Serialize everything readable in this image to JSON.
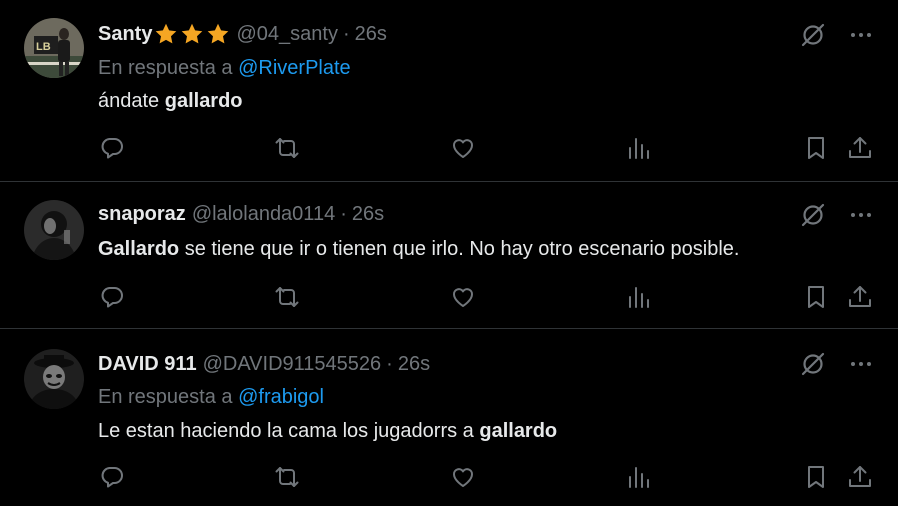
{
  "colors": {
    "background": "#000000",
    "text": "#e7e9ea",
    "muted": "#71767b",
    "link": "#1d9bf0",
    "divider": "#2f3336",
    "star": "#f5a623"
  },
  "tweets": [
    {
      "name": "Santy",
      "badges": [
        "star-icon",
        "star-icon",
        "star-icon"
      ],
      "handle": "@04_santy",
      "dot": "·",
      "time": "26s",
      "reply_prefix": "En respuesta a",
      "reply_to": "@RiverPlate",
      "text_before": "ándate ",
      "text_bold": "gallardo",
      "text_after": ""
    },
    {
      "name": "snaporaz",
      "handle": "@lalolanda0114",
      "dot": "·",
      "time": "26s",
      "text_before": "",
      "text_bold": "Gallardo",
      "text_after": " se tiene que ir o tienen que irlo. No hay otro escenario posible."
    },
    {
      "name": "DAVID 911",
      "handle": "@DAVID911545526",
      "dot": "·",
      "time": "26s",
      "reply_prefix": "En respuesta a",
      "reply_to": "@frabigol",
      "text_before": "Le estan haciendo la cama los jugadorrs a ",
      "text_bold": "gallardo",
      "text_after": ""
    }
  ],
  "icons": {
    "top": [
      "grok-icon",
      "more-icon"
    ],
    "actions": [
      "reply-icon",
      "retweet-icon",
      "like-icon",
      "views-icon",
      "bookmark-icon",
      "share-icon"
    ]
  }
}
